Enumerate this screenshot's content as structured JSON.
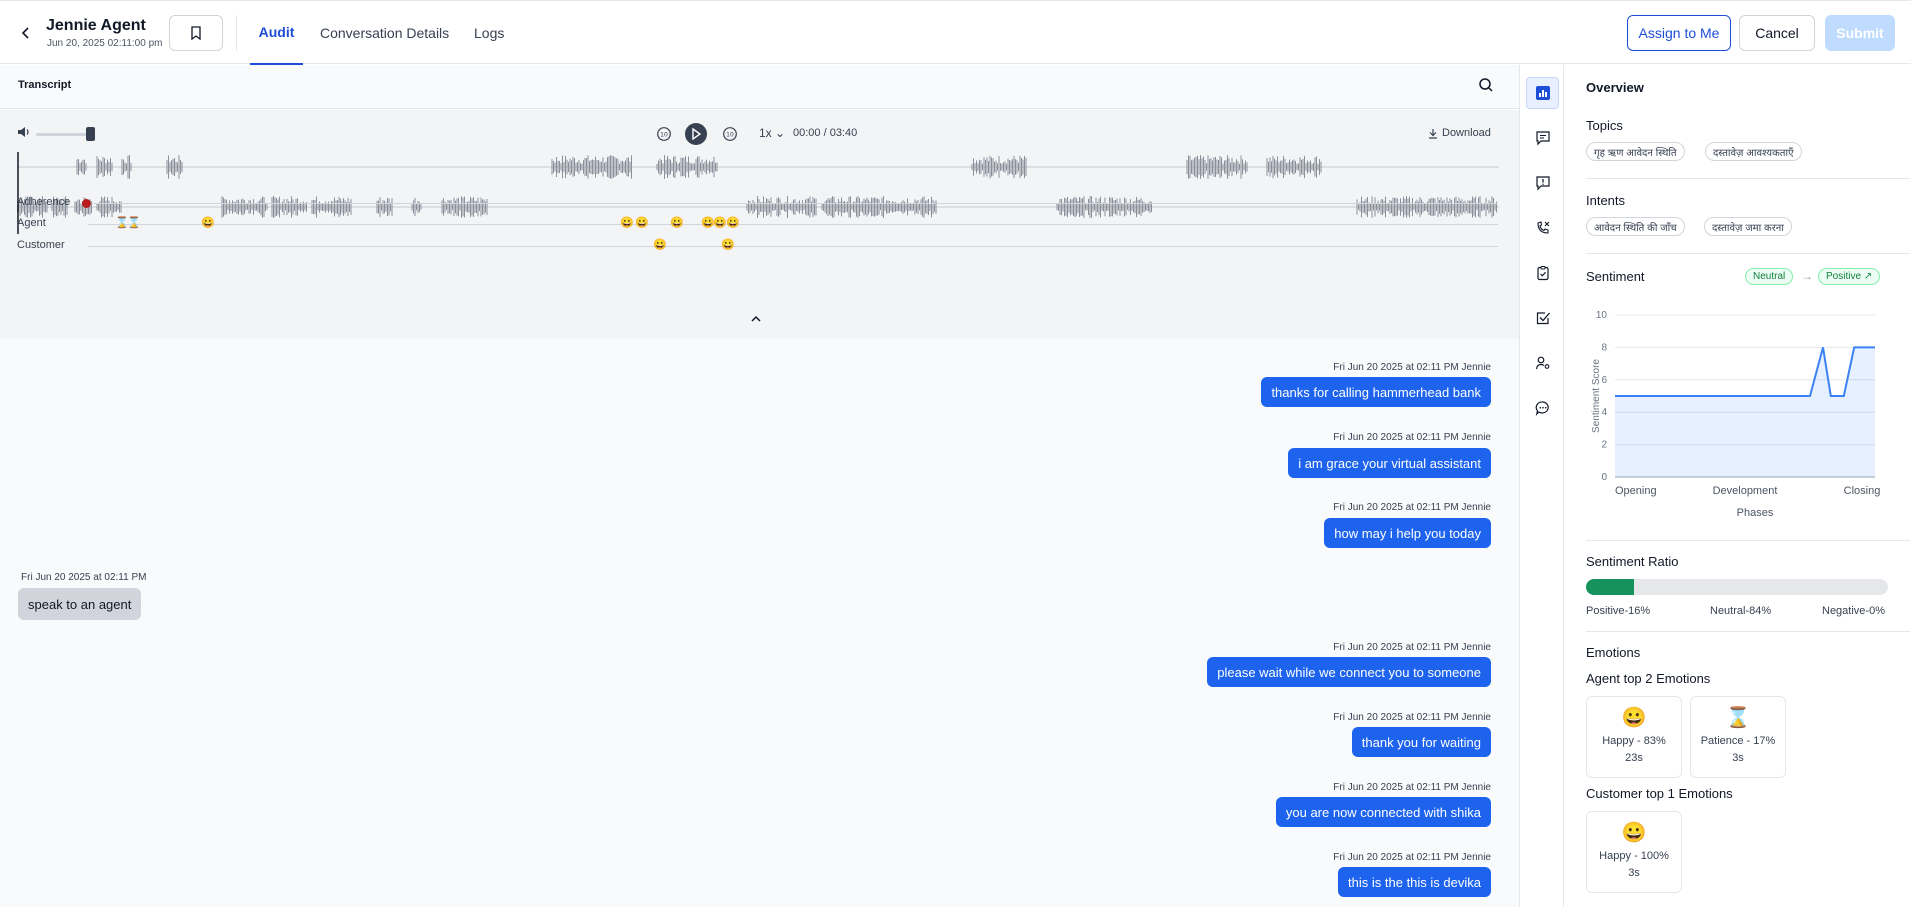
{
  "header": {
    "agent_name": "Jennie Agent",
    "agent_date": "Jun 20, 2025 02:11:00 pm",
    "tabs": [
      {
        "label": "Audit",
        "active": true
      },
      {
        "label": "Conversation Details",
        "active": false
      },
      {
        "label": "Logs",
        "active": false
      }
    ],
    "assign_label": "Assign to Me",
    "cancel_label": "Cancel",
    "submit_label": "Submit"
  },
  "transcript": {
    "title": "Transcript",
    "player": {
      "rate": "1x",
      "time": "00:00 / 03:40",
      "download_label": "Download",
      "volume_level": 0.85
    },
    "tracks": {
      "adherence_label": "Adherence",
      "agent_label": "Agent",
      "customer_label": "Customer"
    },
    "messages": [
      {
        "speaker": "agent",
        "meta": "Fri Jun 20 2025 at 02:11 PM Jennie",
        "text": "thanks for calling hammerhead bank"
      },
      {
        "speaker": "agent",
        "meta": "Fri Jun 20 2025 at 02:11 PM Jennie",
        "text": "i am grace your virtual assistant"
      },
      {
        "speaker": "agent",
        "meta": "Fri Jun 20 2025 at 02:11 PM Jennie",
        "text": "how may i help you today"
      },
      {
        "speaker": "customer",
        "meta": "Fri Jun 20 2025 at 02:11 PM",
        "text": "speak to an agent"
      },
      {
        "speaker": "agent",
        "meta": "Fri Jun 20 2025 at 02:11 PM Jennie",
        "text": "please wait while we connect you to someone"
      },
      {
        "speaker": "agent",
        "meta": "Fri Jun 20 2025 at 02:11 PM Jennie",
        "text": "thank you for waiting"
      },
      {
        "speaker": "agent",
        "meta": "Fri Jun 20 2025 at 02:11 PM Jennie",
        "text": "you are now connected with shika"
      },
      {
        "speaker": "agent",
        "meta": "Fri Jun 20 2025 at 02:11 PM Jennie",
        "text": "this is the this is devika"
      }
    ]
  },
  "rail": {
    "icons": [
      "chart-icon",
      "comment-icon",
      "alert-comment-icon",
      "phone-missed-icon",
      "clipboard-check-icon",
      "checkbox-icon",
      "user-settings-icon",
      "chat-dots-icon"
    ]
  },
  "overview": {
    "title": "Overview",
    "topics_label": "Topics",
    "topics": [
      "गृह ऋण आवेदन स्थिति",
      "दस्तावेज़ आवश्यकताएँ"
    ],
    "intents_label": "Intents",
    "intents": [
      "आवेदन स्थिति की जाँच",
      "दस्तावेज़ जमा करना"
    ],
    "sentiment_label": "Sentiment",
    "sentiment_from": "Neutral",
    "sentiment_to": "Positive ↗",
    "ratio_label": "Sentiment Ratio",
    "ratio": {
      "positive": 16,
      "neutral": 84,
      "negative": 0
    },
    "ratio_labels": {
      "positive": "Positive-16%",
      "neutral": "Neutral-84%",
      "negative": "Negative-0%"
    },
    "emotions_label": "Emotions",
    "agent_emotions_label": "Agent top 2 Emotions",
    "agent_emotions": [
      {
        "icon": "happy-face-icon",
        "label": "Happy - 83%",
        "duration": "23s"
      },
      {
        "icon": "hourglass-icon",
        "label": "Patience - 17%",
        "duration": "3s"
      }
    ],
    "customer_emotions_label": "Customer top 1 Emotions",
    "customer_emotions": [
      {
        "icon": "happy-face-icon",
        "label": "Happy - 100%",
        "duration": "3s"
      }
    ]
  },
  "chart_data": {
    "type": "area",
    "x": [
      0,
      0.1,
      0.2,
      0.3,
      0.4,
      0.5,
      0.6,
      0.7,
      0.75,
      0.8,
      0.83,
      0.88,
      0.92,
      1.0
    ],
    "values": [
      5,
      5,
      5,
      5,
      5,
      5,
      5,
      5,
      5,
      8,
      5,
      5,
      8,
      8
    ],
    "categories": [
      "Opening",
      "Development",
      "Closing"
    ],
    "xlabel": "Phases",
    "ylabel": "Sentiment Score",
    "ylim": [
      0,
      10
    ],
    "yticks": [
      0,
      2,
      4,
      6,
      8,
      10
    ],
    "grid": true,
    "color": "#3b82f6"
  }
}
